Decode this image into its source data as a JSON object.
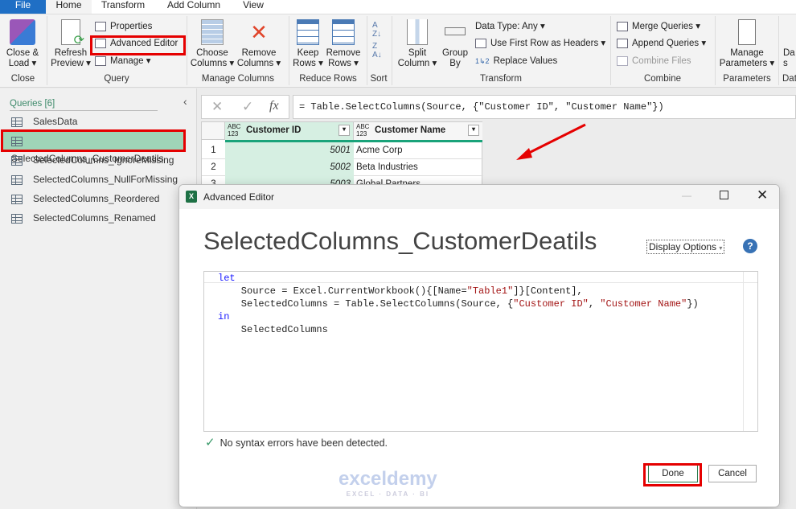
{
  "tabs": [
    "File",
    "Home",
    "Transform",
    "Add Column",
    "View"
  ],
  "ribbon": {
    "close_load": "Close &",
    "close_load2": "Load",
    "close_group": "Close",
    "refresh": "Refresh",
    "refresh2": "Preview",
    "properties": "Properties",
    "advanced_editor": "Advanced Editor",
    "manage": "Manage",
    "query_group": "Query",
    "choose": "Choose",
    "choose2": "Columns",
    "remove": "Remove",
    "remove2": "Columns",
    "manage_cols_group": "Manage Columns",
    "keep": "Keep",
    "keep2": "Rows",
    "remove_rows": "Remove",
    "remove_rows2": "Rows",
    "reduce_group": "Reduce Rows",
    "sort_group": "Sort",
    "split": "Split",
    "split2": "Column",
    "group": "Group",
    "group2": "By",
    "data_type": "Data Type: Any",
    "first_row": "Use First Row as Headers",
    "replace": "Replace Values",
    "transform_group": "Transform",
    "merge": "Merge Queries",
    "append": "Append Queries",
    "combine_files": "Combine Files",
    "combine_group": "Combine",
    "manage_params": "Manage",
    "manage_params2": "Parameters",
    "params_group": "Parameters",
    "data_partial": "Da",
    "data_partial2": "s",
    "data_group_partial": "Dat"
  },
  "queries": {
    "header": "Queries [6]",
    "items": [
      "SalesData",
      "SelectedColumns_CustomerDeatils",
      "SelectedColumns_IgnoreMissing",
      "SelectedColumns_NullForMissing",
      "SelectedColumns_Reordered",
      "SelectedColumns_Renamed"
    ]
  },
  "formula": "= Table.SelectColumns(Source, {\"Customer ID\", \"Customer Name\"})",
  "fx": "fx",
  "grid": {
    "type_badge": "ABC\n123",
    "columns": [
      "Customer ID",
      "Customer Name"
    ],
    "rows": [
      [
        "1",
        "5001",
        "Acme Corp"
      ],
      [
        "2",
        "5002",
        "Beta Industries"
      ],
      [
        "3",
        "5003",
        "Global Partners"
      ]
    ]
  },
  "dialog": {
    "title": "Advanced Editor",
    "query_name": "SelectedColumns_CustomerDeatils",
    "display_options": "Display Options",
    "code": {
      "l1": "let",
      "l2a": "    Source = Excel.CurrentWorkbook(){[Name=",
      "l2s": "\"Table1\"",
      "l2b": "]}[Content],",
      "l3a": "    SelectedColumns = Table.SelectColumns(Source, {",
      "l3s1": "\"Customer ID\"",
      "l3c": ", ",
      "l3s2": "\"Customer Name\"",
      "l3b": "})",
      "l4": "in",
      "l5": "    SelectedColumns"
    },
    "status": "No syntax errors have been detected.",
    "done": "Done",
    "cancel": "Cancel"
  },
  "watermark": {
    "brand": "exceldemy",
    "tagline": "EXCEL · DATA · BI"
  },
  "colors": {
    "file_tab": "#1f6fc5",
    "selected_query": "#9fd5b7",
    "highlight": "#e50000",
    "accent_green": "#1aa37a"
  }
}
